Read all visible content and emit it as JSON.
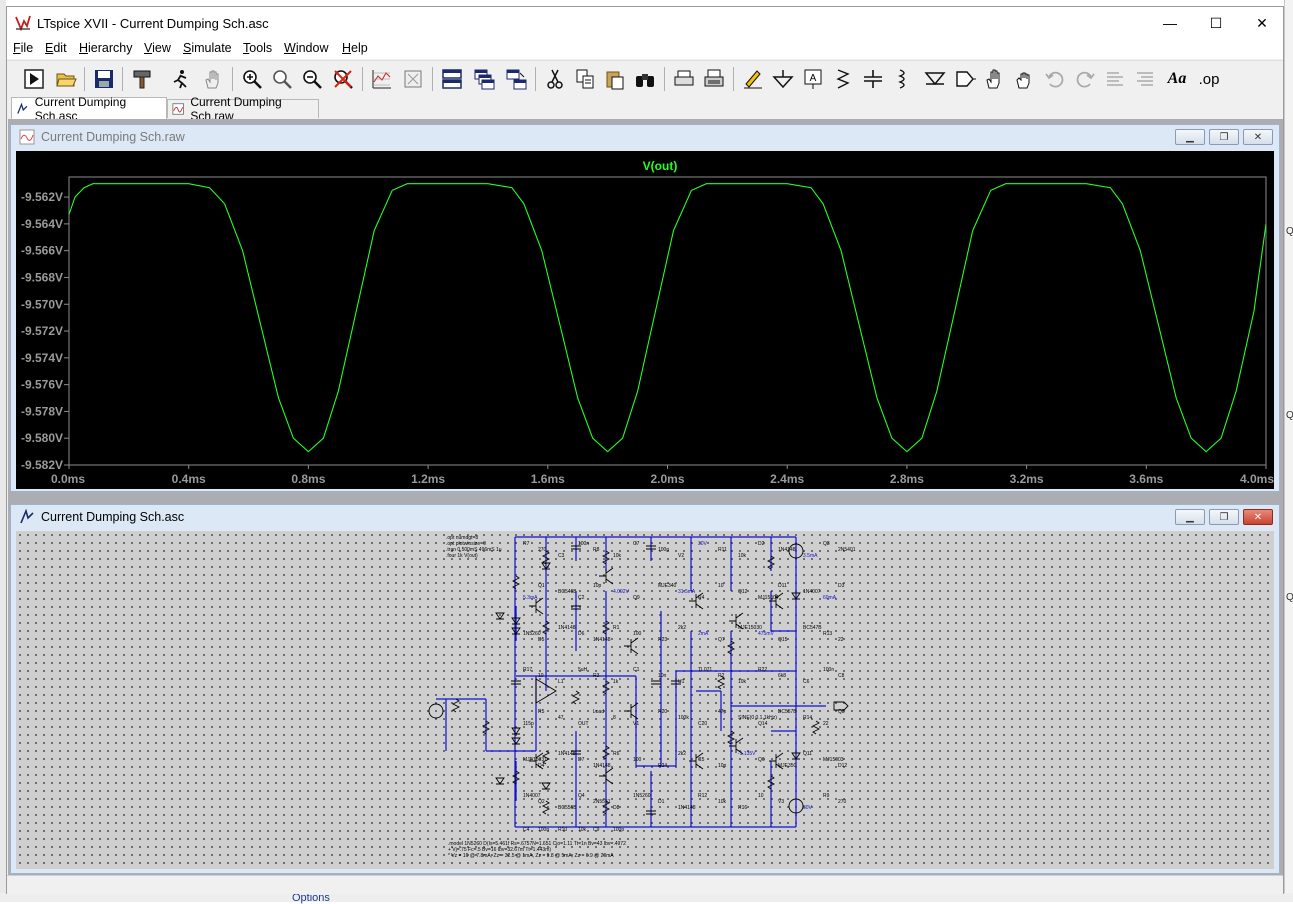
{
  "app": {
    "title": "LTspice XVII - Current Dumping Sch.asc",
    "window_controls": {
      "minimize": "—",
      "maximize": "☐",
      "close": "✕"
    }
  },
  "menu": {
    "items": [
      {
        "id": "file",
        "mnemonic": "F",
        "rest": "ile"
      },
      {
        "id": "edit",
        "mnemonic": "E",
        "rest": "dit"
      },
      {
        "id": "hierarchy",
        "mnemonic": "H",
        "rest": "ierarchy"
      },
      {
        "id": "view",
        "mnemonic": "V",
        "rest": "iew"
      },
      {
        "id": "simulate",
        "mnemonic": "S",
        "rest": "imulate"
      },
      {
        "id": "tools",
        "mnemonic": "T",
        "rest": "ools"
      },
      {
        "id": "window",
        "mnemonic": "W",
        "rest": "indow"
      },
      {
        "id": "help",
        "mnemonic": "H",
        "rest": "elp"
      }
    ]
  },
  "toolbar": {
    "buttons": [
      "run",
      "open",
      "save",
      "control-panel",
      "halt",
      "pan",
      "zoom-in",
      "zoom-full",
      "zoom-out",
      "zoom-cancel",
      "autorange",
      "fit-to-window",
      "tile-vertical",
      "cascade",
      "tile-horizontal",
      "cut",
      "copy",
      "paste",
      "find",
      "print-preview",
      "print",
      "draw-wire",
      "ground",
      "label-net",
      "resistor",
      "capacitor",
      "inductor",
      "diode",
      "component",
      "move",
      "drag",
      "undo",
      "redo",
      "rotate",
      "mirror",
      "text",
      "spice-directive"
    ],
    "text_label": "Aa",
    "op_label": ".op"
  },
  "tabs": [
    {
      "label": "Current Dumping Sch.asc",
      "active": true
    },
    {
      "label": "Current Dumping Sch.raw",
      "active": false
    }
  ],
  "plot_window": {
    "title": "Current Dumping Sch.raw",
    "trace_name": "V(out)",
    "trace_color": "#22ff22",
    "y_ticks": [
      "-9.562V",
      "-9.564V",
      "-9.566V",
      "-9.568V",
      "-9.570V",
      "-9.572V",
      "-9.574V",
      "-9.576V",
      "-9.578V",
      "-9.580V",
      "-9.582V"
    ],
    "x_ticks": [
      "0.0ms",
      "0.4ms",
      "0.8ms",
      "1.2ms",
      "1.6ms",
      "2.0ms",
      "2.4ms",
      "2.8ms",
      "3.2ms",
      "3.6ms",
      "4.0ms"
    ]
  },
  "chart_data": {
    "type": "line",
    "title": "V(out)",
    "xlabel": "",
    "ylabel": "",
    "xlim": [
      0,
      4
    ],
    "ylim": [
      -9.582,
      -9.5605
    ],
    "x_unit": "ms",
    "y_unit": "V",
    "grid": false,
    "series": [
      {
        "name": "V(out)",
        "color": "#22ff22",
        "x": [
          0.0,
          0.02,
          0.05,
          0.08,
          0.12,
          0.2,
          0.3,
          0.4,
          0.47,
          0.52,
          0.58,
          0.64,
          0.7,
          0.75,
          0.8,
          0.85,
          0.9,
          0.96,
          1.02,
          1.08,
          1.13,
          1.2,
          1.3,
          1.4,
          1.48,
          1.52,
          1.58,
          1.64,
          1.7,
          1.75,
          1.8,
          1.85,
          1.9,
          1.96,
          2.02,
          2.08,
          2.13,
          2.2,
          2.3,
          2.4,
          2.48,
          2.52,
          2.58,
          2.64,
          2.7,
          2.75,
          2.8,
          2.85,
          2.9,
          2.96,
          3.02,
          3.08,
          3.13,
          3.2,
          3.3,
          3.4,
          3.48,
          3.52,
          3.58,
          3.64,
          3.7,
          3.75,
          3.8,
          3.85,
          3.9,
          3.96,
          4.0
        ],
        "y": [
          -9.5633,
          -9.562,
          -9.5613,
          -9.561,
          -9.561,
          -9.561,
          -9.561,
          -9.561,
          -9.5613,
          -9.5625,
          -9.566,
          -9.5715,
          -9.577,
          -9.58,
          -9.581,
          -9.58,
          -9.5765,
          -9.5705,
          -9.5645,
          -9.5615,
          -9.561,
          -9.561,
          -9.561,
          -9.561,
          -9.5613,
          -9.5625,
          -9.566,
          -9.5715,
          -9.577,
          -9.58,
          -9.581,
          -9.58,
          -9.5765,
          -9.5705,
          -9.5645,
          -9.5615,
          -9.561,
          -9.561,
          -9.561,
          -9.561,
          -9.5613,
          -9.5625,
          -9.566,
          -9.5715,
          -9.577,
          -9.58,
          -9.581,
          -9.58,
          -9.5765,
          -9.5705,
          -9.5645,
          -9.5615,
          -9.561,
          -9.561,
          -9.561,
          -9.561,
          -9.5613,
          -9.5625,
          -9.566,
          -9.5715,
          -9.577,
          -9.58,
          -9.581,
          -9.58,
          -9.5765,
          -9.5705,
          -9.564
        ]
      }
    ]
  },
  "schematic_window": {
    "title": "Current Dumping Sch.asc",
    "directives": [
      ".opt numdgt=8",
      ".opt plotwinsize=0",
      ".tran 0 500mS 496mS 1u",
      ".four 1k V(out)"
    ],
    "model_note": [
      ".model 1N5260 D(Is=5.461f Rs=.6757N=1.651 Cjo=1.11 Tt=1n Bv=43 Ibv=.4972",
      "+ Vj=.75 Fc=.5 Bv=16 Ibv=32.67m Tt=1.443m)",
      "* Vz = 16 @ 7.8mA, Zz = 32.5 @ 1mA, Zz = 9.8 @ 5mA, Zz = 6.9 @ 20mA"
    ],
    "labels": [
      {
        "t": "R7"
      },
      {
        "t": "270"
      },
      {
        "t": "C3"
      },
      {
        "t": "100n"
      },
      {
        "t": "R8"
      },
      {
        "t": "10k"
      },
      {
        "t": "C7"
      },
      {
        "t": "100p"
      },
      {
        "t": "V2"
      },
      {
        "t": "30V"
      },
      {
        "t": "R11"
      },
      {
        "t": "10k"
      },
      {
        "t": "D2"
      },
      {
        "t": "1N4148"
      },
      {
        "t": "3.5mA"
      },
      {
        "t": "Q3"
      },
      {
        "t": "2N5401"
      },
      {
        "t": "5.3mA"
      },
      {
        "t": "Q1"
      },
      {
        "t": "BC546B"
      },
      {
        "t": "C2"
      },
      {
        "t": "10p"
      },
      {
        "t": "4.092V"
      },
      {
        "t": "Q9"
      },
      {
        "t": "MJE340"
      },
      {
        "t": "31.5mA"
      },
      {
        "t": "R4"
      },
      {
        "t": "10"
      },
      {
        "t": "Q12"
      },
      {
        "t": "MJ15004"
      },
      {
        "t": "D11"
      },
      {
        "t": "1N4007"
      },
      {
        "t": "60mA"
      },
      {
        "t": "D3"
      },
      {
        "t": "1N5260"
      },
      {
        "t": "D5"
      },
      {
        "t": "1N4148"
      },
      {
        "t": "D6"
      },
      {
        "t": "1N4148"
      },
      {
        "t": "R1"
      },
      {
        "t": "100"
      },
      {
        "t": "R23"
      },
      {
        "t": "2k2"
      },
      {
        "t": "2mA"
      },
      {
        "t": "Q7"
      },
      {
        "t": "MJE15030"
      },
      {
        "t": "475mV"
      },
      {
        "t": "Q15"
      },
      {
        "t": "BC547B"
      },
      {
        "t": "R13"
      },
      {
        "t": "22"
      },
      {
        "t": "R17"
      },
      {
        "t": "10"
      },
      {
        "t": "L1"
      },
      {
        "t": "5uH"
      },
      {
        "t": "R3"
      },
      {
        "t": "1k"
      },
      {
        "t": "C1"
      },
      {
        "t": "10n"
      },
      {
        "t": "U1"
      },
      {
        "t": "TL071"
      },
      {
        "t": "R2"
      },
      {
        "t": "10k"
      },
      {
        "t": "R22"
      },
      {
        "t": "6k8"
      },
      {
        "t": "C6"
      },
      {
        "t": "100n"
      },
      {
        "t": "C8"
      },
      {
        "t": "115p"
      },
      {
        "t": "R5"
      },
      {
        "t": "47"
      },
      {
        "t": "OUT"
      },
      {
        "t": "Load"
      },
      {
        "t": "8"
      },
      {
        "t": "V1"
      },
      {
        "t": "R20"
      },
      {
        "t": "100k"
      },
      {
        "t": "C20"
      },
      {
        "t": "47p"
      },
      {
        "t": "SINE(0 0.1 1kHz)"
      },
      {
        "t": "Q14"
      },
      {
        "t": "BC557B"
      },
      {
        "t": "R14"
      },
      {
        "t": "22"
      },
      {
        "t": "Q8"
      },
      {
        "t": "MJE15031"
      },
      {
        "t": "D4"
      },
      {
        "t": "1N4148"
      },
      {
        "t": "D7"
      },
      {
        "t": "1N4148"
      },
      {
        "t": "R6"
      },
      {
        "t": "100"
      },
      {
        "t": "R24"
      },
      {
        "t": "2k2"
      },
      {
        "t": "C5"
      },
      {
        "t": "10p"
      },
      {
        "t": "-1.135V"
      },
      {
        "t": "Q6"
      },
      {
        "t": "MJE350"
      },
      {
        "t": "Q11"
      },
      {
        "t": "MJ15003"
      },
      {
        "t": "D12"
      },
      {
        "t": "1N4007"
      },
      {
        "t": "Q2"
      },
      {
        "t": "BC556B"
      },
      {
        "t": "Q4"
      },
      {
        "t": "2N5551"
      },
      {
        "t": "D8"
      },
      {
        "t": "1N5260"
      },
      {
        "t": "D1"
      },
      {
        "t": "1N4148"
      },
      {
        "t": "R12"
      },
      {
        "t": "10k"
      },
      {
        "t": "R16"
      },
      {
        "t": "10"
      },
      {
        "t": "V3"
      },
      {
        "t": "30V"
      },
      {
        "t": "R9"
      },
      {
        "t": "270"
      },
      {
        "t": "C4"
      },
      {
        "t": "100n"
      },
      {
        "t": "R10"
      },
      {
        "t": "10k"
      },
      {
        "t": "C9"
      },
      {
        "t": "100p"
      }
    ]
  },
  "statusbar": {
    "text": ""
  },
  "background_fragments": {
    "options": "Options",
    "right_q": "Q"
  }
}
